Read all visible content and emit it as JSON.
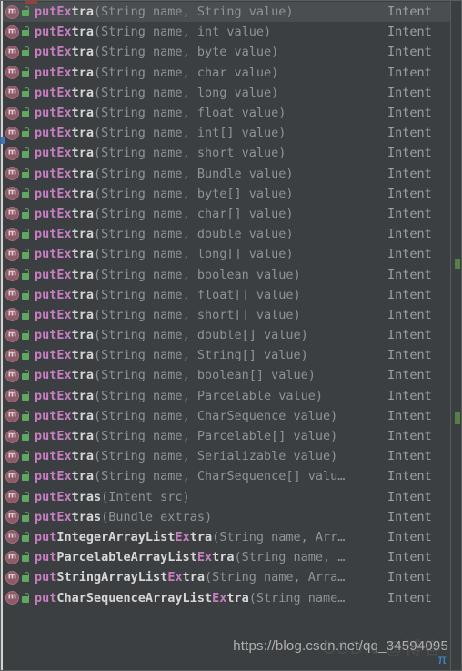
{
  "popup": {
    "kind": "code-completion-popup",
    "colors": {
      "background": "#3c3f41",
      "selected_row": "#4b4e50",
      "match_highlight": "#c77ec0",
      "name_text": "#d6d6d6",
      "params_text": "#8e9396",
      "return_type_text": "#9aa0a4",
      "border": "#5a5d5e",
      "icon_method": "#8d5a67",
      "icon_public_lock": "#5ea85f"
    },
    "icons": {
      "method": "method-icon",
      "visibility": "public-lock-icon"
    },
    "selected_index": 0,
    "rows": [
      {
        "hit": "putEx",
        "plain": "tra",
        "params": "(String name, String value)",
        "ret": "Intent",
        "selected": true
      },
      {
        "hit": "putEx",
        "plain": "tra",
        "params": "(String name, int value)",
        "ret": "Intent",
        "selected": false
      },
      {
        "hit": "putEx",
        "plain": "tra",
        "params": "(String name, byte value)",
        "ret": "Intent",
        "selected": false
      },
      {
        "hit": "putEx",
        "plain": "tra",
        "params": "(String name, char value)",
        "ret": "Intent",
        "selected": false
      },
      {
        "hit": "putEx",
        "plain": "tra",
        "params": "(String name, long value)",
        "ret": "Intent",
        "selected": false
      },
      {
        "hit": "putEx",
        "plain": "tra",
        "params": "(String name, float value)",
        "ret": "Intent",
        "selected": false
      },
      {
        "hit": "putEx",
        "plain": "tra",
        "params": "(String name, int[] value)",
        "ret": "Intent",
        "selected": false
      },
      {
        "hit": "putEx",
        "plain": "tra",
        "params": "(String name, short value)",
        "ret": "Intent",
        "selected": false
      },
      {
        "hit": "putEx",
        "plain": "tra",
        "params": "(String name, Bundle value)",
        "ret": "Intent",
        "selected": false
      },
      {
        "hit": "putEx",
        "plain": "tra",
        "params": "(String name, byte[] value)",
        "ret": "Intent",
        "selected": false
      },
      {
        "hit": "putEx",
        "plain": "tra",
        "params": "(String name, char[] value)",
        "ret": "Intent",
        "selected": false
      },
      {
        "hit": "putEx",
        "plain": "tra",
        "params": "(String name, double value)",
        "ret": "Intent",
        "selected": false
      },
      {
        "hit": "putEx",
        "plain": "tra",
        "params": "(String name, long[] value)",
        "ret": "Intent",
        "selected": false
      },
      {
        "hit": "putEx",
        "plain": "tra",
        "params": "(String name, boolean value)",
        "ret": "Intent",
        "selected": false
      },
      {
        "hit": "putEx",
        "plain": "tra",
        "params": "(String name, float[] value)",
        "ret": "Intent",
        "selected": false
      },
      {
        "hit": "putEx",
        "plain": "tra",
        "params": "(String name, short[] value)",
        "ret": "Intent",
        "selected": false
      },
      {
        "hit": "putEx",
        "plain": "tra",
        "params": "(String name, double[] value)",
        "ret": "Intent",
        "selected": false
      },
      {
        "hit": "putEx",
        "plain": "tra",
        "params": "(String name, String[] value)",
        "ret": "Intent",
        "selected": false
      },
      {
        "hit": "putEx",
        "plain": "tra",
        "params": "(String name, boolean[] value)",
        "ret": "Intent",
        "selected": false
      },
      {
        "hit": "putEx",
        "plain": "tra",
        "params": "(String name, Parcelable value)",
        "ret": "Intent",
        "selected": false
      },
      {
        "hit": "putEx",
        "plain": "tra",
        "params": "(String name, CharSequence value)",
        "ret": "Intent",
        "selected": false
      },
      {
        "hit": "putEx",
        "plain": "tra",
        "params": "(String name, Parcelable[] value)",
        "ret": "Intent",
        "selected": false
      },
      {
        "hit": "putEx",
        "plain": "tra",
        "params": "(String name, Serializable value)",
        "ret": "Intent",
        "selected": false
      },
      {
        "hit": "putEx",
        "plain": "tra",
        "params": "(String name, CharSequence[] valu…",
        "ret": "Intent",
        "selected": false
      },
      {
        "hit": "putEx",
        "plain": "tras",
        "params": "(Intent src)",
        "ret": "Intent",
        "selected": false
      },
      {
        "hit": "putEx",
        "plain": "tras",
        "params": "(Bundle extras)",
        "ret": "Intent",
        "selected": false
      },
      {
        "hit": "put",
        "plain": "IntegerArrayList",
        "hit2": "Ex",
        "plain2": "tra",
        "params": "(String name, Arr…",
        "ret": "Intent",
        "selected": false
      },
      {
        "hit": "put",
        "plain": "ParcelableArrayList",
        "hit2": "Ex",
        "plain2": "tra",
        "params": "(String name, …",
        "ret": "Intent",
        "selected": false
      },
      {
        "hit": "put",
        "plain": "StringArrayList",
        "hit2": "Ex",
        "plain2": "tra",
        "params": "(String name, Arra…",
        "ret": "Intent",
        "selected": false
      },
      {
        "hit": "put",
        "plain": "CharSequenceArrayList",
        "hit2": "Ex",
        "plain2": "tra",
        "params": "(String name…",
        "ret": "Intent",
        "selected": false
      }
    ]
  },
  "watermark": {
    "url": "https://blog.csdn.net/qq_34594095",
    "logo": "π",
    "ghost": "CSDN @博客"
  }
}
